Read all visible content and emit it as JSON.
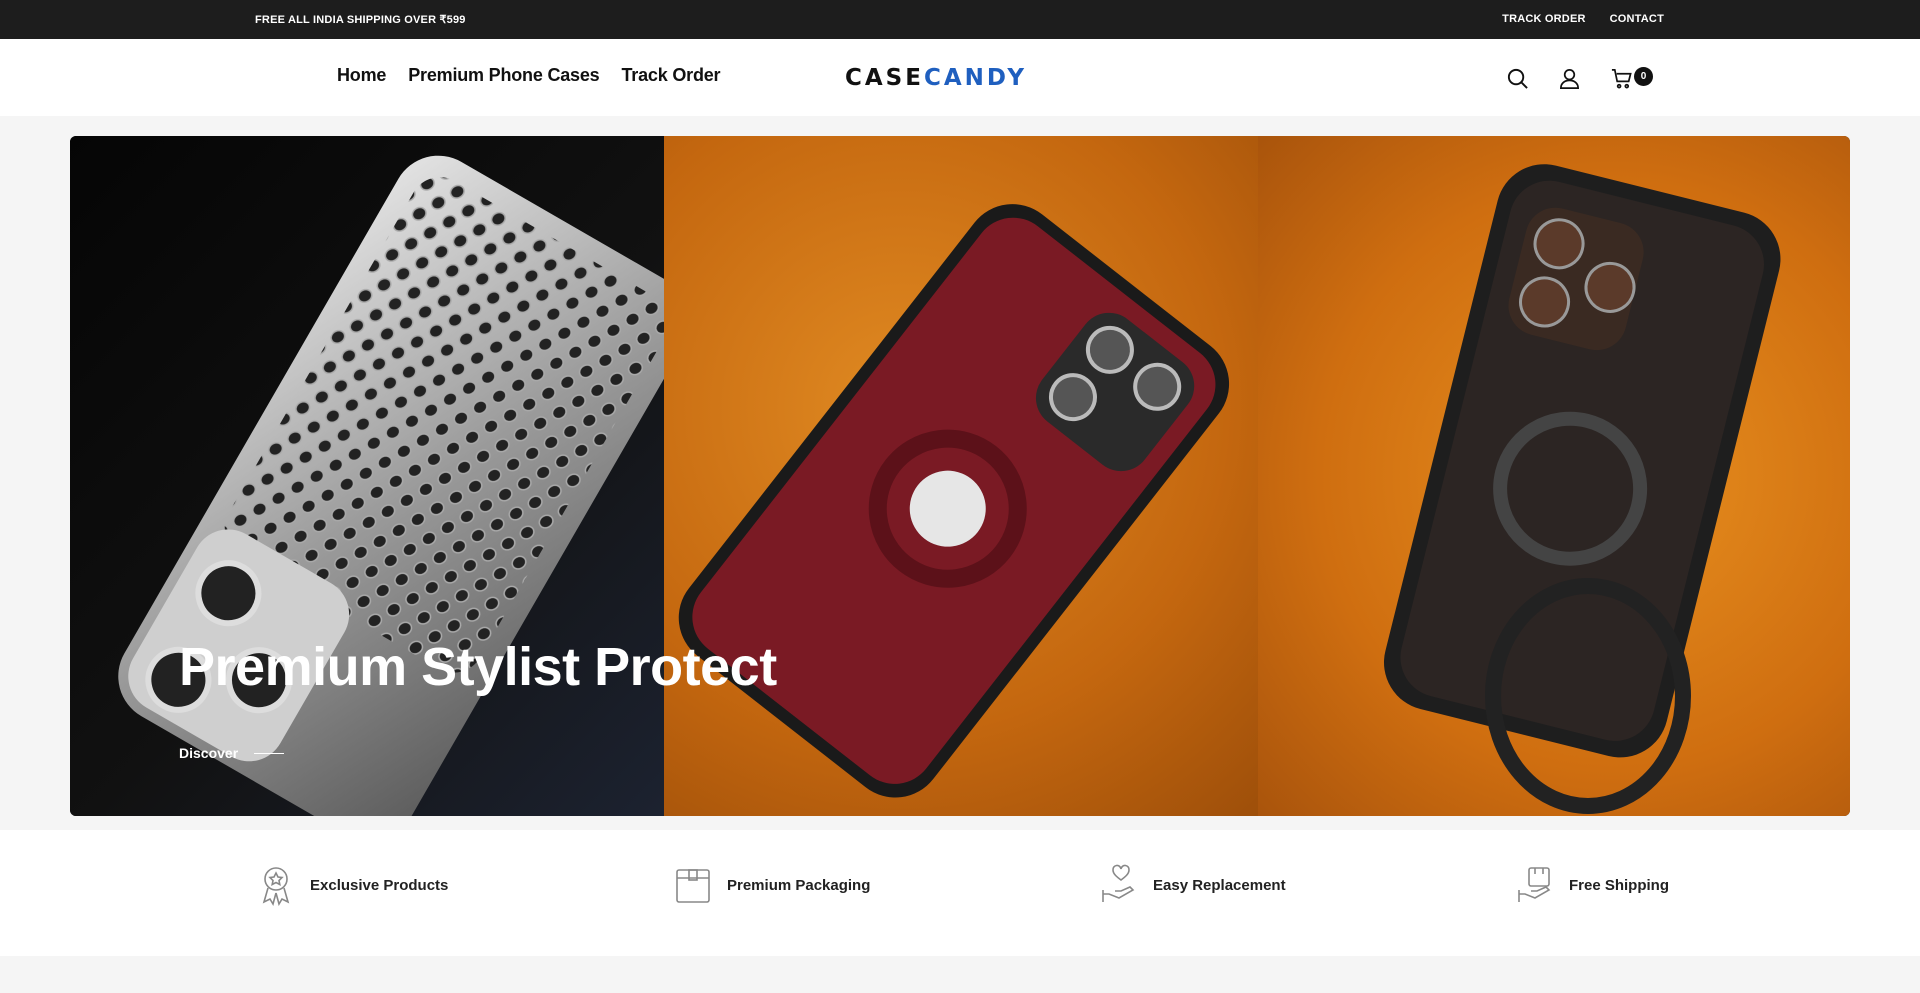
{
  "announcement": {
    "shipping": "FREE ALL INDIA SHIPPING OVER ₹599",
    "links": [
      "TRACK ORDER",
      "CONTACT"
    ]
  },
  "header": {
    "nav": [
      "Home",
      "Premium Phone Cases",
      "Track Order"
    ],
    "logo": {
      "part1": "CASE",
      "part2": "CANDY"
    },
    "cart_count": "0"
  },
  "hero": {
    "title": "Premium Stylist Protect",
    "cta": "Discover"
  },
  "features": [
    "Exclusive Products",
    "Premium Packaging",
    "Easy Replacement",
    "Free Shipping"
  ],
  "colors": {
    "announcement_bg": "#1d1d1d",
    "logo_accent": "#1f5fbf",
    "hero_orange": "#d9781a",
    "hero_maroon": "#7a1a24"
  },
  "icons": [
    "search-icon",
    "account-icon",
    "cart-icon",
    "award-icon",
    "box-icon",
    "hand-heart-icon",
    "truck-hand-icon"
  ]
}
